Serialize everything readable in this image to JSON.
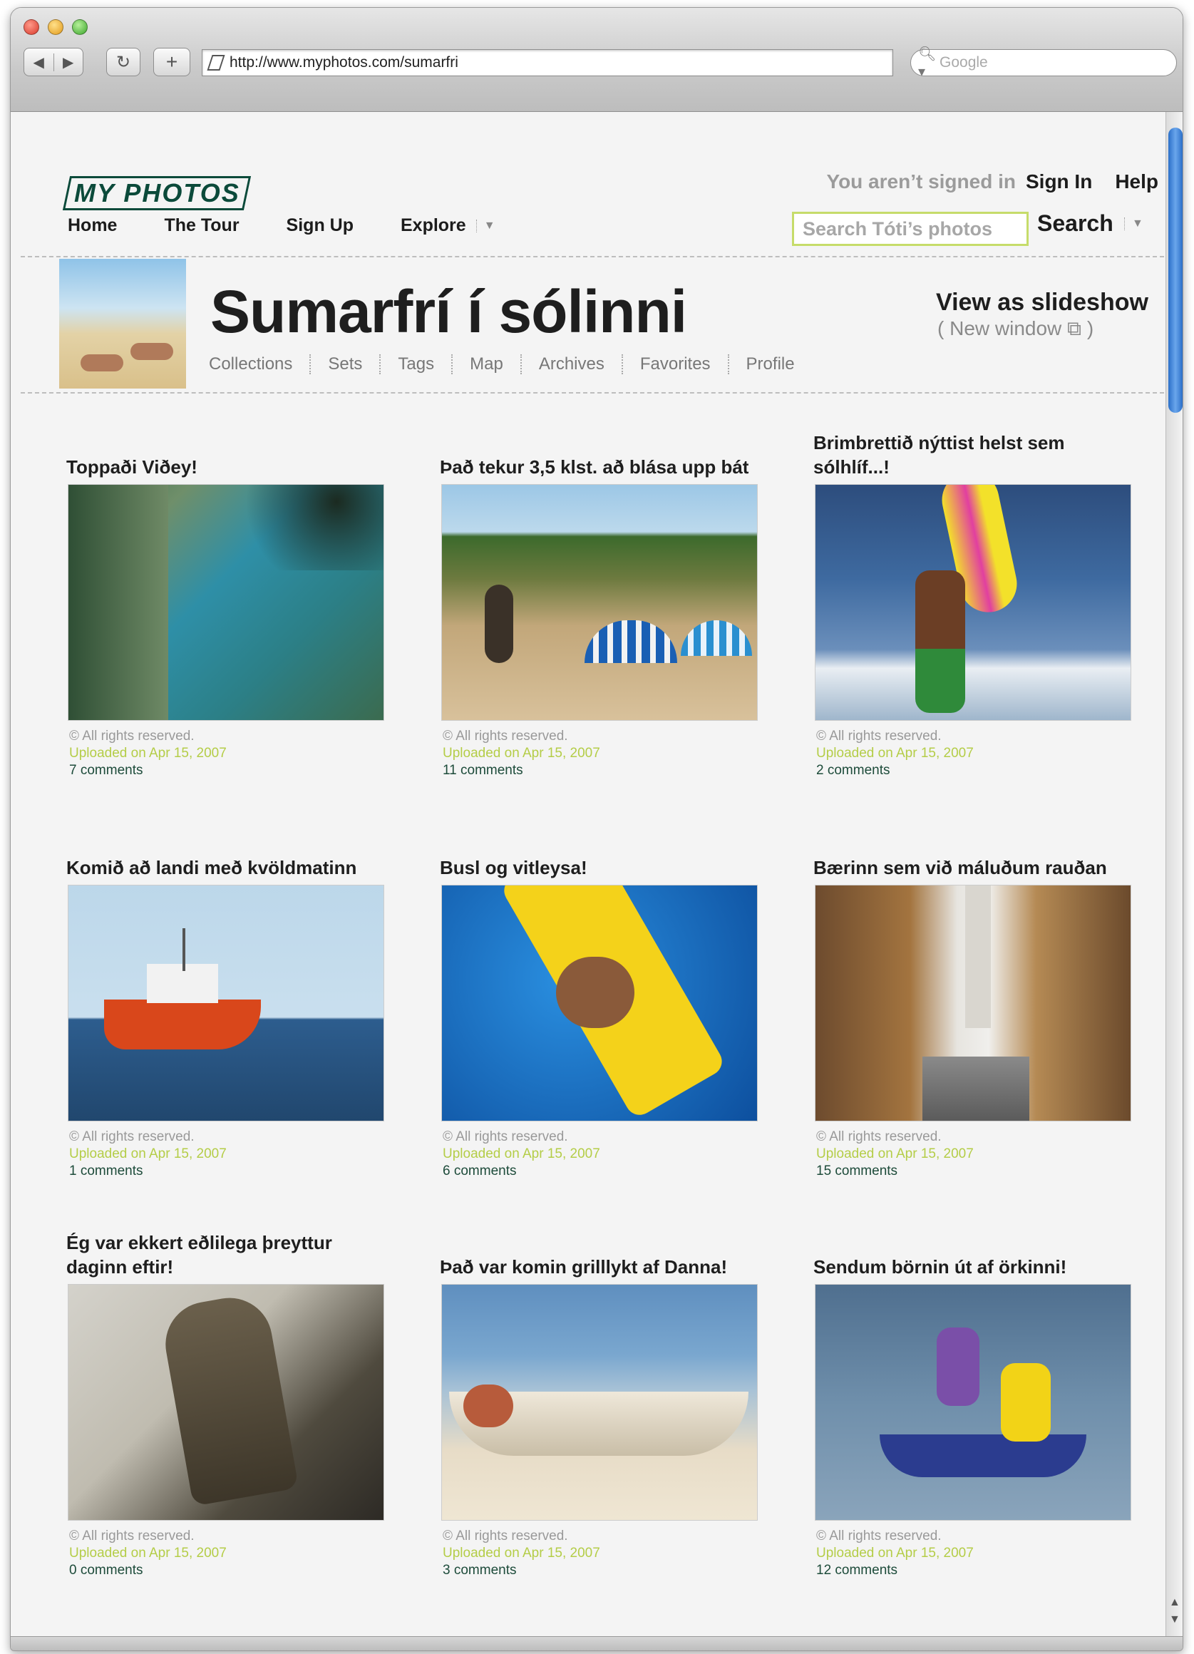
{
  "browser": {
    "url": "http://www.myphotos.com/sumarfri",
    "search_placeholder": "Google"
  },
  "site": {
    "logo": "MY PHOTOS",
    "nav": [
      "Home",
      "The Tour",
      "Sign Up",
      "Explore"
    ],
    "signed_status": "You aren’t signed in",
    "sign_in": "Sign In",
    "help": "Help",
    "search_placeholder": "Search Tóti’s photos",
    "search_button": "Search"
  },
  "album": {
    "title": "Sumarfrí í sólinni",
    "subnav": [
      "Collections",
      "Sets",
      "Tags",
      "Map",
      "Archives",
      "Favorites",
      "Profile"
    ],
    "slideshow": "View as slideshow",
    "new_window": "( New window ⧉ )"
  },
  "photos": [
    {
      "title": "Toppaði Viðey!",
      "rights": "© All rights reserved.",
      "uploaded": "Uploaded on Apr 15, 2007",
      "comments": "7 comments"
    },
    {
      "title": "Það tekur 3,5 klst. að blása upp bát",
      "rights": "© All rights reserved.",
      "uploaded": "Uploaded on Apr 15, 2007",
      "comments": "11 comments"
    },
    {
      "title": "Brimbrettið nýttist helst sem sólhlíf...!",
      "rights": "© All rights reserved.",
      "uploaded": "Uploaded on Apr 15, 2007",
      "comments": "2 comments"
    },
    {
      "title": "Komið að landi með kvöldmatinn",
      "rights": "© All rights reserved.",
      "uploaded": "Uploaded on Apr 15, 2007",
      "comments": "1 comments"
    },
    {
      "title": "Busl og vitleysa!",
      "rights": "© All rights reserved.",
      "uploaded": "Uploaded on Apr 15, 2007",
      "comments": "6 comments"
    },
    {
      "title": "Bærinn sem við máluðum rauðan",
      "rights": "© All rights reserved.",
      "uploaded": "Uploaded on Apr 15, 2007",
      "comments": "15 comments"
    },
    {
      "title": "Ég var ekkert eðlilega þreyttur daginn eftir!",
      "rights": "© All rights reserved.",
      "uploaded": "Uploaded on Apr 15, 2007",
      "comments": "0 comments"
    },
    {
      "title": "Það var komin grilllykt af  Danna!",
      "rights": "© All rights reserved.",
      "uploaded": "Uploaded on Apr 15, 2007",
      "comments": "3 comments"
    },
    {
      "title": "Sendum börnin út af örkinni!",
      "rights": "© All rights reserved.",
      "uploaded": "Uploaded on Apr 15, 2007",
      "comments": "12 comments"
    }
  ]
}
